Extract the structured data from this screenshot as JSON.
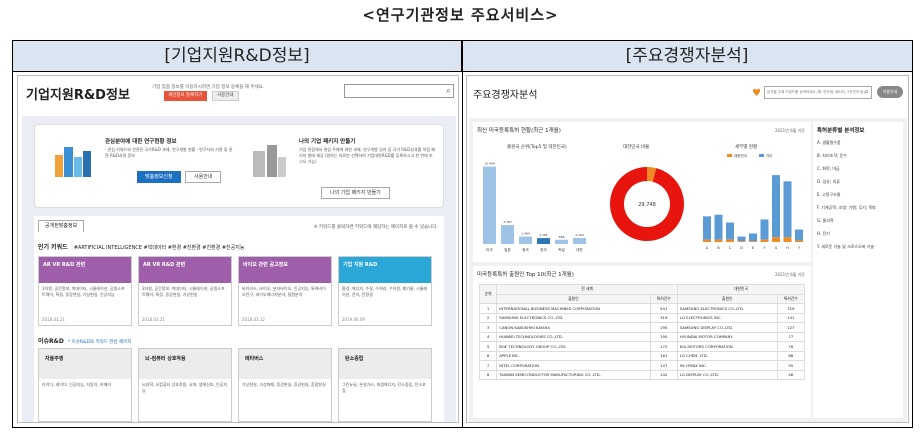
{
  "page_title": "<연구기관정보 주요서비스>",
  "left_header": "[기업지원R&D정보]",
  "right_header": "[주요경쟁자분석]",
  "left": {
    "title": "기업지원R&D정보",
    "desc": "기업 맞춤 정보를 이용하시려면 기업 정보 등록을 해 주세요.",
    "btn_register": "개인정보 등록하기",
    "btn_guide": "사용안내",
    "card1_head": "관심분야에 대한 연구현황 정보",
    "card1_text": "· 관심 키워드와 연관된 국가R&D 과제, 연구개발 현황\n· 연구자와 기관 및 관련 R&D과정 정보",
    "card1_btn1": "맞춤정보신청",
    "card1_btn2": "사용안내",
    "card2_head": "나의 기업 패키지 만들기",
    "card2_text": "기업 관점에서 관심 주제에 대한 과제, 연구개발 성과 등 국가 R&D성과를 직접 패키지 형태 제공\n(원하는 자료만 선택하여 기업대한R&D를 등록하시고 한 번에 보시오 가능)",
    "card2_btn": "나의 기업 패키지 만들기",
    "tab_label": "공개된맞춤정보",
    "note": "※ 키워드를 클릭하면 키워드에 해당하는 페이지로 볼 수 있습니다.",
    "kw_head": "인기 키워드",
    "kw_list": "#ARTIFICIAL INTELLIGENCE   #빅데이터   #환경   #친환경 #친환경   #친공지능",
    "kcards": [
      {
        "title": "AR VR R&D 관련",
        "body": "3차원, 공간정보, 빅데이터, 시뮬레이션, 공원소프트웨어, 특정, 증강현실, 가상현실, 인공지능",
        "date": "2018.03.21",
        "color": "#9f5ea9"
      },
      {
        "title": "AR VR R&D 관련",
        "body": "3차원, 공간정보, 빅데이터, 시뮬레이션, 공원소프트웨어, 특정, 증강현실, 가상현실",
        "date": "2018.03.21",
        "color": "#9f5ea9"
      },
      {
        "title": "바이오 관련 공고정보",
        "body": "바이러스, 바이오, 분자바이오, 인공지능, 특허바이오연구, 바이오에너지분야, 질환분야",
        "date": "2018.03.12",
        "color": "#9f5ea9"
      },
      {
        "title": "기업 지원 R&D",
        "body": "환경, 에너지, 수질, 수처리, 수자원, 폐기물, 시뮬레이션, 전자, 전환경",
        "date": "2019.06.09",
        "color": "#2aa7d6"
      }
    ],
    "issue_head": "이슈R&D",
    "issue_link": "* 이슈R&D와 키워드 관련 페이지",
    "icards": [
      {
        "title": "자율주행",
        "body": "라이다, 레이더, 인공지능, 자동차, 카메라"
      },
      {
        "title": "뇌-컴퓨터 상호작용",
        "body": "뇌과학, 뇌컴퓨터 상호작용, 뇌파, 생체신호, 인공지능"
      },
      {
        "title": "메타버스",
        "body": "가상현실, 가상화폐, 증강현실, 증강현실, 혼합현실"
      },
      {
        "title": "탄소중립",
        "body": "그린뉴딜, 온실가스, 재생에너지, 탄소중립, 탄소포집"
      }
    ]
  },
  "right": {
    "title": "주요경쟁자분석",
    "search_placeholder": "분석할 주제 키워드를 검색하세요 (예: 반도체, 배터리, 2차전지 등)",
    "btn_label": "이용안내",
    "chart_title": "최신 미국등록특허 현황(최근 1개월)",
    "chart_date": "2021년 6월 기준",
    "sub1": "출원국 순위(Top5 및 대한민국)",
    "sub2": "대한민국 비율",
    "sub3": "세부별 현황",
    "donut_value": "29,748",
    "legend1": "대한민국",
    "legend2": "기타",
    "table_title": "미국등록특허 출원인 Top 10(최근 1개월)",
    "table_date": "2021년 6월 기준",
    "col_rank": "순위",
    "col_world": "전 세계",
    "col_korea": "대한민국",
    "col_applicant": "출원인",
    "col_count": "특허건수",
    "rows": [
      [
        "1",
        "INTERNATIONAL BUSINESS MACHINES CORPORATION",
        "541",
        "SAMSUNG ELECTRONICS CO.,LTD.",
        "319"
      ],
      [
        "2",
        "SAMSUNG ELECTRONICS CO.,LTD.",
        "319",
        "LG ELECTRONICS INC.",
        "141"
      ],
      [
        "3",
        "CANON KABUSHIKI KAISHA",
        "195",
        "SAMSUNG DISPLAY CO.,LTD.",
        "127"
      ],
      [
        "4",
        "HUAWEI TECHNOLOGIES CO.,LTD.",
        "190",
        "HYUNDAI MOTOR COMPANY",
        "77"
      ],
      [
        "5",
        "BOE TECHNOLOGY GROUP CO.,LTD.",
        "172",
        "KIA MOTORS CORPORATION",
        "76"
      ],
      [
        "6",
        "APPLE INC.",
        "161",
        "LG CHEM, LTD.",
        "68"
      ],
      [
        "7",
        "INTEL CORPORATION",
        "147",
        "SK HYNIX INC.",
        "55"
      ],
      [
        "8",
        "TAIWAN SEMICONDUCTOR MANUFACTURING CO.,LTD.",
        "142",
        "LG DISPLAY CO.,LTD.",
        "48"
      ]
    ],
    "side_head": "특허분류별 분석정보",
    "side_items": [
      "A. 생활필수품",
      "B. 처리조작; 운수",
      "C. 화학; 야금",
      "D. 섬유; 지류",
      "E. 고정구조물",
      "F. 기계공학; 조명; 가열; 무기; 폭파",
      "G. 물리학",
      "H. 전기",
      "Y. 새로운 기술 및 크로스오버 기술"
    ]
  },
  "chart_data": [
    {
      "type": "bar",
      "title": "출원국 순위(Top5 및 대한민국)",
      "categories": [
        "미국",
        "일본",
        "중국",
        "한국",
        "독일",
        "대만"
      ],
      "values": [
        15494,
        3787,
        1484,
        1181,
        838,
        1194
      ],
      "xlabel": "",
      "ylabel": ""
    },
    {
      "type": "pie",
      "title": "대한민국 비율",
      "categories": [
        "대한민국",
        "기타"
      ],
      "values": [
        4,
        96
      ]
    },
    {
      "type": "bar",
      "title": "세부별 현황",
      "categories": [
        "A",
        "B",
        "C",
        "D",
        "E",
        "F",
        "G",
        "H",
        "Y"
      ],
      "series": [
        {
          "name": "대한민국",
          "values": [
            3,
            3,
            3,
            1,
            1,
            3,
            6,
            6,
            2
          ]
        },
        {
          "name": "기타",
          "values": [
            30,
            32,
            22,
            6,
            10,
            26,
            80,
            72,
            14
          ]
        }
      ]
    }
  ]
}
